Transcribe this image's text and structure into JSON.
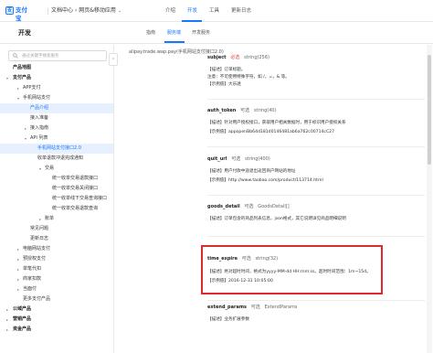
{
  "brand": {
    "logo_mark": "支",
    "logo_text": "支付宝",
    "logo_sub": "ALIPAY"
  },
  "app_title": "文档中心 ‹ 网页&移动应用",
  "top_nav": [
    {
      "label": "介绍"
    },
    {
      "label": "开发"
    },
    {
      "label": "工具"
    },
    {
      "label": "更新日志"
    }
  ],
  "page_title": "开发",
  "sub_tabs": [
    {
      "label": "指南"
    },
    {
      "label": "服务端"
    },
    {
      "label": "开发服务"
    }
  ],
  "search": {
    "placeholder": "通过关键字搜索服务"
  },
  "sidebar": {
    "items": [
      {
        "label": "产品地图"
      },
      {
        "label": "支付产品"
      },
      {
        "label": "APP支付"
      },
      {
        "label": "手机网站支付"
      },
      {
        "label": "产品介绍"
      },
      {
        "label": "接入准备"
      },
      {
        "label": "接入指南"
      },
      {
        "label": "API 列表"
      },
      {
        "label": "手机网站支付接口2.0"
      },
      {
        "label": "收单退款冲退完成通知"
      },
      {
        "label": "交易"
      },
      {
        "label": "统一收单交易退款接口"
      },
      {
        "label": "统一收单交易关闭接口"
      },
      {
        "label": "统一收单线下交易查询接口"
      },
      {
        "label": "统一收单交易退款查询"
      },
      {
        "label": "账单"
      },
      {
        "label": "常见问题"
      },
      {
        "label": "更新日志"
      },
      {
        "label": "电脑网站支付"
      },
      {
        "label": "预授权支付"
      },
      {
        "label": "单笔代扣"
      },
      {
        "label": "商家扣款"
      },
      {
        "label": "当面付"
      },
      {
        "label": "更多支付产品"
      },
      {
        "label": "公域产品"
      },
      {
        "label": "营销产品"
      },
      {
        "label": "资金产品"
      }
    ]
  },
  "breadcrumb": "alipay.trade.wap.pay(手机网站支付接口2.0)",
  "params": [
    {
      "name": "subject",
      "required": "必选",
      "type": "string(256)",
      "desc": [
        "【描述】订单标题。",
        "注意：不可使用特殊字符，如 /，=，& 等。",
        "【示例值】大乐透"
      ]
    },
    {
      "name": "auth_token",
      "required": "可选",
      "type": "string(40)",
      "desc": [
        "【描述】针对用户授权接口，获取用户相关数据时，用于标识用户授权关系",
        "【示例值】appopenBb64d181d0146481ab6a762c00714cC27"
      ]
    },
    {
      "name": "quit_url",
      "required": "可选",
      "type": "string(400)",
      "desc": [
        "【描述】用户付款中途退出返回商户网站的地址",
        "【示例值】http://www.taobao.com/product/113714.html"
      ]
    },
    {
      "name": "goods_detail",
      "required": "可选",
      "type": "GoodsDetail[]",
      "desc": [
        "【描述】订单包含的商品列表信息，json格式，其它说明详见商品明细说明"
      ]
    },
    {
      "name": "time_expire",
      "required": "可选",
      "type": "string(32)",
      "desc": [
        "【描述】绝对超时时间，格式为yyyy-MM-dd HH:mm:ss。超时时间范围：1m~15d。",
        "【示例值】2016-12-31 10:05:00"
      ]
    },
    {
      "name": "extend_params",
      "required": "可选",
      "type": "ExtendParams",
      "desc": [
        "【描述】业务扩展参数"
      ]
    }
  ]
}
